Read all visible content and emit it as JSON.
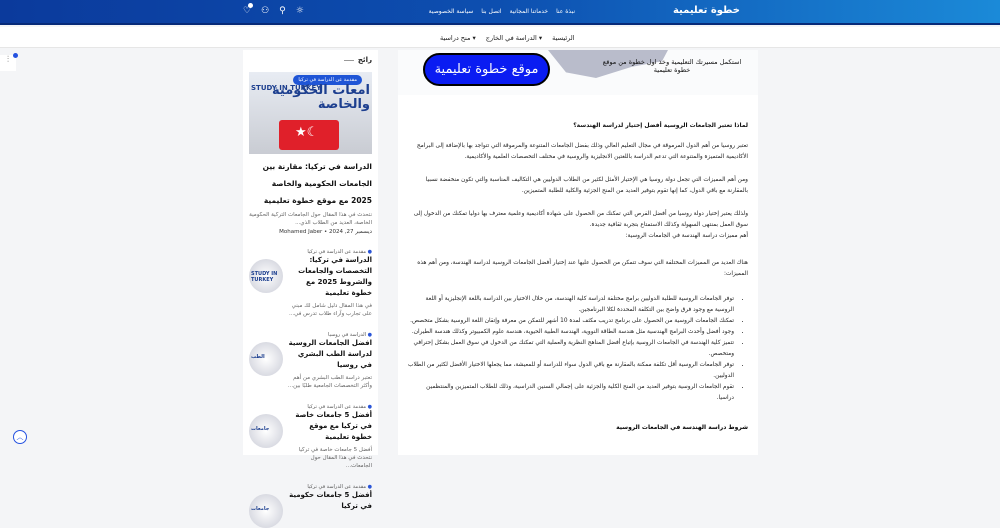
{
  "header": {
    "brand": "خطوة تعليمية",
    "links": [
      "نبذة عنا",
      "خدماتنا المجانية",
      "اتصل بنا",
      "سياسة الخصوصية"
    ]
  },
  "subnav": [
    "الرئيسية",
    "الدراسة في الخارج ▾",
    "منح دراسية ▾"
  ],
  "sidebar": {
    "heading": "رائج",
    "featured": {
      "pill": "مقدمة عن الدراسة في تركيا",
      "image_title": "امعات الحكومية والخاصة",
      "image_study": "STUDY IN TURKEY",
      "title": "الدراسة في تركيا: مقارنة بين الجامعات الحكومية والخاصة 2025 مع موقع خطوة تعليمية",
      "excerpt": "نتحدث في هذا المقال حول الجامعات التركية الحكومية الخاصة، العديد من الطلاب الذي...",
      "author": "Mohamed Jaber",
      "date": "ديسمبر 27, 2024"
    },
    "posts": [
      {
        "cat": "مقدمة عن الدراسة في تركيا",
        "title": "الدراسة في تركيا: التخصصات والجامعات والشروط 2025 مع خطوة تعليمية",
        "excerpt": "في هذا المقال دليل شامل لك مبني على تجارب وآراء طلاب تدرس في...",
        "thumb": "STUDY IN TURKEY"
      },
      {
        "cat": "الدراسة في روسيا",
        "title": "افضل الجامعات الروسية لدراسة الطب البشري في روسيا",
        "excerpt": "تعتبر دراسة الطب البشري من أهم وأكثر التخصصات الجامعية طلبًا بين...",
        "thumb": "الطب"
      },
      {
        "cat": "مقدمة عن الدراسة في تركيا",
        "title": "أفضل 5 جامعات خاصة في تركيا مع موقع خطوة تعليمية",
        "excerpt": "أفضل 5 جامعات خاصة في تركيا نتحدث في هذا المقال حول الجامعات...",
        "thumb": "جامعات"
      },
      {
        "cat": "مقدمة عن الدراسة في تركيا",
        "title": "أفضل 5 جامعات حكومية في تركيا",
        "excerpt": "",
        "thumb": "جامعات"
      }
    ]
  },
  "article": {
    "banner_button": "موقع خطوة تعليمية",
    "banner_tagline": "استكمل مسيرتك التعليمية وخذ اول خطوة من موقع خطوة تعليمية",
    "heading": "لماذا تعتبر الجامعات الروسية أفضل إختيار لدراسة الهندسة؟",
    "paragraphs": [
      "تعتبر روسيا من أهم الدول المرموقة في مجال التعليم العالي وذلك بفضل الجامعات المتنوعة والمرموقة التي تتواجد بها بالإضافة إلى البرامج الأكاديمية المتميزة والمتنوعة التي تدعم الدراسة باللغتين الانجليزية والروسية في مختلف التخصصات العلمية والأكاديمية.",
      "ومن أهم المميزات التي تجعل دولة روسيا هي الإختيار الأمثل لكثير من الطلاب الدوليين هي التكاليف المناسبة والتي تكون منخفضة نسبيا بالمقارنة مع باقي الدول، كما إنها تقوم بتوفير العديد من المنح الجزئية والكلية للطلبة المتميزين.",
      "ولذلك يعتبر إختيار دولة روسيا من أفضل الفرص التي تمكنك من الحصول على شهادة أكاديمية وعلمية معترف بها دوليا تمكنك من الدخول إلى سوق العمل بمنتهى السهولة وكذلك الاستمتاع بتجربة ثقافية جديدة.",
      "أهم مميزات دراسة الهندسة في الجامعات الروسية:",
      "هناك العديد من المميزات المختلفة التي سوف تتمكن من الحصول عليها عند إختيار أفضل الجامعات الروسية لدراسة الهندسة، ومن أهم هذه المميزات:"
    ],
    "bullets": [
      "توفر الجامعات الروسية للطلبة الدوليين برامج مختلفة لدراسة كلية الهندسة، من خلال الاختيار بين الدراسة باللغة الإنجليزية أو اللغة الروسية مع وجود فرق واضح بين التكلفة المحددة لكلا البرنامجين.",
      "تمكنك الجامعات الروسية من الحصول على برنامج تدريب مكثف لمدة 10 أشهر للتمكن من معرفة وإتقان اللغة الروسية بشكل متخصص.",
      "وجود أفضل وأحدث البرامج الهندسية مثل هندسة الطاقة النووية، الهندسة الطبية الحيوية، هندسة علوم الكمبيوتر وكذلك هندسة الطيران.",
      "تتميز كلية الهندسة في الجامعات الروسية بإتباع أفضل المناهج النظرية والعملية التي تمكنك من الدخول في سوق العمل بشكل إحترافي ومتخصص.",
      "توفر الجامعات الروسية أقل تكلفة ممكنة بالمقارنة مع باقي الدول سواء للدراسة أو للمعيشة، مما يجعلها الاختيار الأفضل لكثير من الطلاب الدوليين.",
      "تقوم الجامعات الروسية بتوفير العديد من المنح الكلية والجزئية على إجمالي السنين الدراسية، وذلك للطلاب المتميزين والمنتظمين دراسيا."
    ],
    "subheading": "شروط دراسة الهندسة في الجامعات الروسية"
  }
}
